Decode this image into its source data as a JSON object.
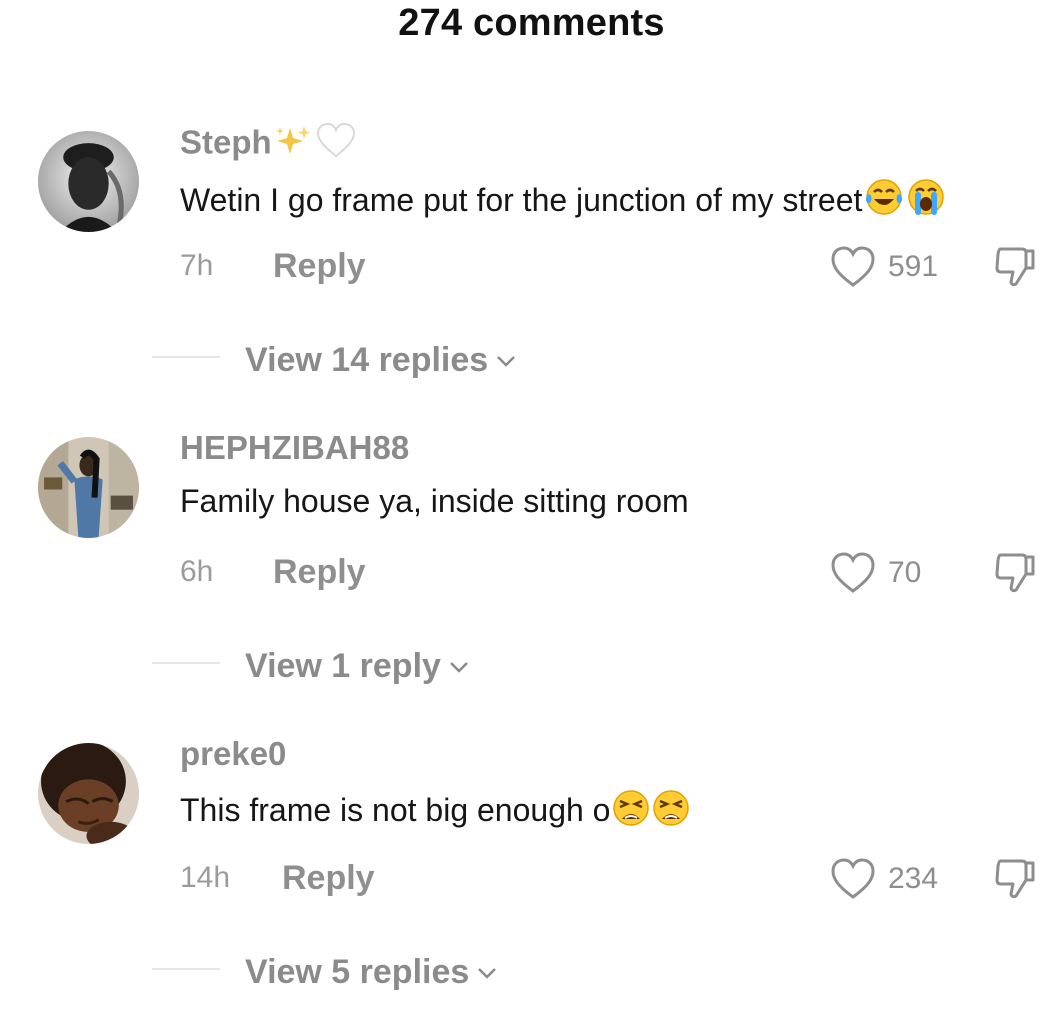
{
  "header": {
    "title": "274 comments"
  },
  "comments": [
    {
      "username": "Steph",
      "username_emojis": [
        "sparkles",
        "white-heart"
      ],
      "text": "Wetin I go frame put for the junction of my street",
      "text_emojis": [
        "face-with-tears-of-joy",
        "loudly-crying-face"
      ],
      "time": "7h",
      "reply_label": "Reply",
      "likes": "591",
      "view_replies": "View 14 replies"
    },
    {
      "username": "HEPHZIBAH88",
      "username_emojis": [],
      "text": "Family house ya, inside sitting room",
      "text_emojis": [],
      "time": "6h",
      "reply_label": "Reply",
      "likes": "70",
      "view_replies": "View 1 reply"
    },
    {
      "username": "preke0",
      "username_emojis": [],
      "text": "This frame is not big enough o",
      "text_emojis": [
        "weary-face",
        "weary-face"
      ],
      "time": "14h",
      "reply_label": "Reply",
      "likes": "234",
      "view_replies": "View 5 replies"
    }
  ],
  "colors": {
    "text": "#161616",
    "muted": "#8b8b8b",
    "divider": "#e6e6e6"
  }
}
